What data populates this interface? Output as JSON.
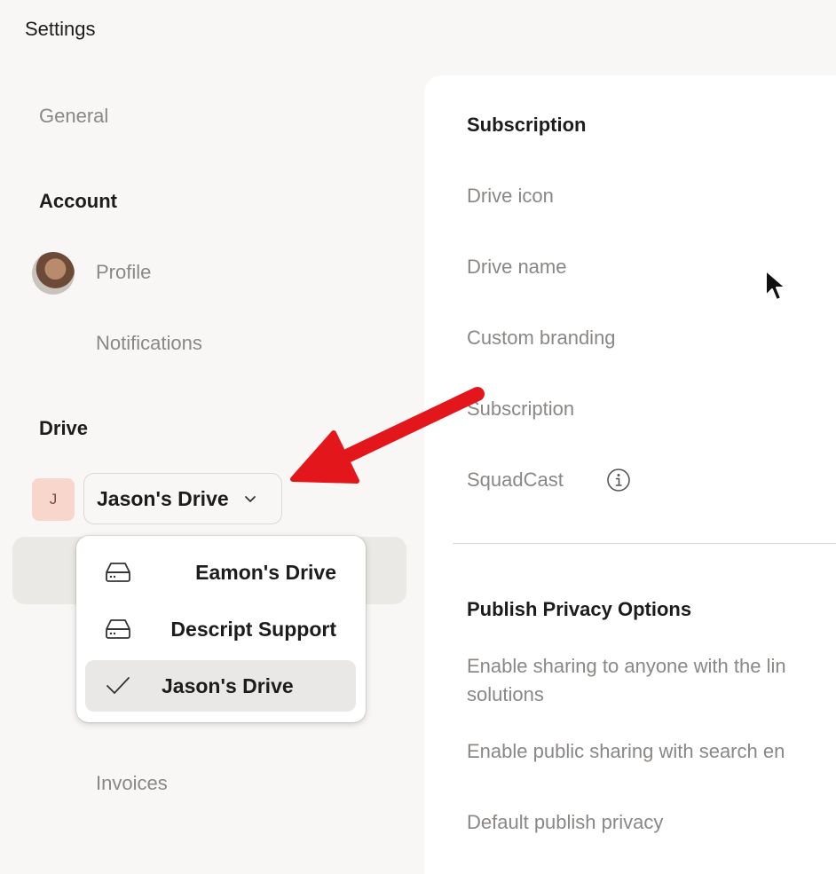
{
  "window": {
    "title": "Settings"
  },
  "sidebar": {
    "general_label": "General",
    "account": {
      "heading": "Account",
      "profile_label": "Profile",
      "notifications_label": "Notifications"
    },
    "drive": {
      "heading": "Drive",
      "badge_letter": "J",
      "selector_value": "Jason's Drive",
      "invoices_label": "Invoices"
    }
  },
  "drive_dropdown": {
    "items": [
      {
        "label": "Eamon's Drive",
        "icon": "drive-icon",
        "selected": false
      },
      {
        "label": "Descript Support",
        "icon": "drive-icon",
        "selected": false
      },
      {
        "label": "Jason's Drive",
        "icon": "checkmark-icon",
        "selected": true
      }
    ]
  },
  "main": {
    "subscription": {
      "heading": "Subscription",
      "rows": [
        "Drive icon",
        "Drive name",
        "Custom branding",
        "Subscription",
        "SquadCast"
      ]
    },
    "privacy": {
      "heading": "Publish Privacy Options",
      "rows": [
        "Enable sharing to anyone with the lin",
        "solutions",
        "Enable public sharing with search en",
        "Default publish privacy"
      ]
    }
  },
  "colors": {
    "background": "#f8f7f5",
    "panel": "#ffffff",
    "annotation_arrow": "#e3161b",
    "badge": "#f9d6cc"
  }
}
